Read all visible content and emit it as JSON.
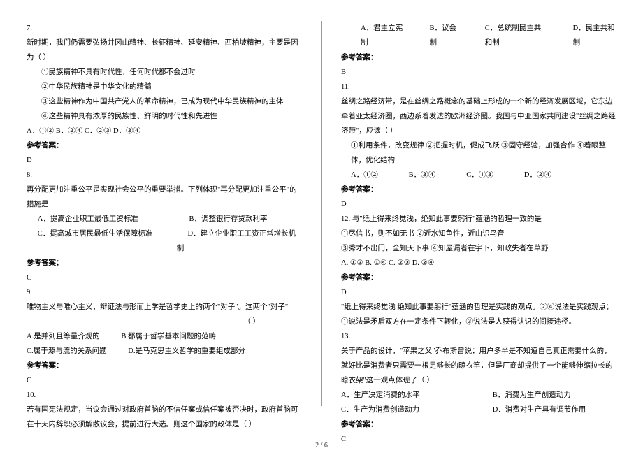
{
  "left": {
    "q7": {
      "num": "7.",
      "stem": "新时期，我们仍需要弘扬井冈山精神、长征精神、延安精神、西柏坡精神，主要是因为（ ）",
      "sub1": "①民族精神不具有时代性，任何时代都不会过时",
      "sub2": "②中华民族精神是中华文化的精髓",
      "sub3": "③这些精神作为中国共产党人的革命精神，已成为现代中华民族精神的主体",
      "sub4": "④这些精神具有浓厚的民族性、鲜明的时代性和先进性",
      "opts": "A．①②       B．②④       C．②③       D．③④",
      "ans_label": "参考答案：",
      "ans": "D"
    },
    "q8": {
      "num": "8.",
      "stem": "再分配更加注重公平是实现社会公平的重要举措。下列体现\"再分配更加注重公平\"的措施是",
      "optA": "A．提高企业职工最低工资标准",
      "optB": "B．调整银行存贷款利率",
      "optC": "C．提高城市居民最低生活保障标准",
      "optD": "D．建立企业职工工资正常增长机制",
      "ans_label": "参考答案：",
      "ans": "C"
    },
    "q9": {
      "num": "9.",
      "stem": "唯物主义与唯心主义，辩证法与形而上学是哲学史上的两个\"对子\"。这两个\"对子\"",
      "blank": "（    ）",
      "optA": "A.是并列且等量齐观的",
      "optB": "B.都属于哲学基本问题的范畴",
      "optC": "C.属于源与流的关系问题",
      "optD": "D.是马克思主义哲学的重要组成部分",
      "ans_label": "参考答案：",
      "ans": "C"
    },
    "q10": {
      "num": "10.",
      "stem": "若有国宪法规定，当议会通过对政府首脑的不信任案或信任案被否决时，政府首脑可在十天内辞职必须解散议会，提前进行大选。则这个国家的政体是（  ）"
    }
  },
  "right": {
    "q10opts": {
      "a": "A．君主立宪制",
      "b": "B．议会制",
      "c": "C．总统制民主共和制",
      "d": "D．民主共和制"
    },
    "q10": {
      "ans_label": "参考答案：",
      "ans": "B"
    },
    "q11": {
      "num": "11.",
      "stem": "丝绸之路经济带，是在丝绸之路概念的基础上形成的一个新的经济发展区域，它东边牵着亚太经济圈，西边系着发达的欧洲经济圈。我国与中亚国家共同建设\"丝绸之路经济带\"，应该（  ）",
      "subs": "①利用条件，改变规律 ②把握时机，促成飞跃 ③固守经验，加强合作 ④着眼整体，优化结构",
      "opts_a": "A．①②",
      "opts_b": "B．③④",
      "opts_c": "C．①③",
      "opts_d": "D．②④",
      "ans_label": "参考答案：",
      "ans": "D"
    },
    "q12": {
      "num_stem": "12. 与\"纸上得来终觉浅，绝知此事要躬行\"蕴涵的哲理一致的是",
      "sub12": "①尽信书，则不如无书           ②近水知鱼性，近山识鸟音",
      "sub34": "③秀才不出门，全知天下事     ④知屋漏者在宇下，知政失者在草野",
      "opts": "A. ①②         B. ①④         C. ②③         D. ②④",
      "ans_label": "参考答案：",
      "ans": "D",
      "explain": "\"纸上得来终觉浅 绝知此事要躬行\"蕴涵的哲理是实践的观点。②④说法是实践观点；①说法是矛盾双方在一定条件下转化，③说法是人获得认识的间接途径。"
    },
    "q13": {
      "num": "13.",
      "stem": "关于产品的设计，\"苹果之父\"乔布斯曾说：用户多半是不知道自己真正需要什么的，就好比是消费者只需要一根足够长的晾衣竿，但是厂商却提供了一个能够伸缩拉长的晾衣架\"这一观点体现了（  ）",
      "optA": "A．生产决定消费的水平",
      "optB": "B．消费为生产创造动力",
      "optC": "C．生产为消费创造动力",
      "optD": "D．消费对生产具有调节作用",
      "ans_label": "参考答案：",
      "ans": "C"
    }
  },
  "footer": "2 / 6"
}
